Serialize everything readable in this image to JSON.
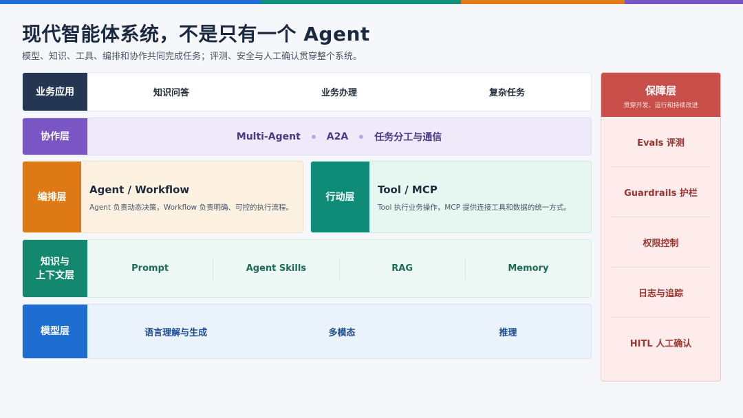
{
  "header": {
    "title": "现代智能体系统，不是只有一个 Agent",
    "subtitle": "模型、知识、工具、编排和协作共同完成任务；评测、安全与人工确认贯穿整个系统。"
  },
  "layers": {
    "app": {
      "label": "业务应用",
      "items": [
        "知识问答",
        "业务办理",
        "复杂任务"
      ]
    },
    "collab": {
      "label": "协作层",
      "items": [
        "Multi-Agent",
        "A2A",
        "任务分工与通信"
      ]
    },
    "orchestration": {
      "label": "编排层",
      "title": "Agent / Workflow",
      "desc": "Agent 负责动态决策，Workflow 负责明确、可控的执行流程。"
    },
    "action": {
      "label": "行动层",
      "title": "Tool / MCP",
      "desc": "Tool 执行业务操作，MCP 提供连接工具和数据的统一方式。"
    },
    "knowledge": {
      "label_line1": "知识与",
      "label_line2": "上下文层",
      "items": [
        "Prompt",
        "Agent Skills",
        "RAG",
        "Memory"
      ]
    },
    "model": {
      "label": "模型层",
      "items": [
        "语言理解与生成",
        "多模态",
        "推理"
      ]
    }
  },
  "guard": {
    "title": "保障层",
    "subtitle": "贯穿开发、运行和持续改进",
    "items": [
      "Evals 评测",
      "Guardrails 护栏",
      "权限控制",
      "日志与追踪",
      "HITL 人工确认"
    ]
  },
  "colors": {
    "accent_blue": "#1d6fd6",
    "accent_teal": "#11917a",
    "accent_orange": "#e07b18",
    "accent_purple": "#7a55c4",
    "guard_red": "#c9504a",
    "app_navy": "#243652"
  }
}
